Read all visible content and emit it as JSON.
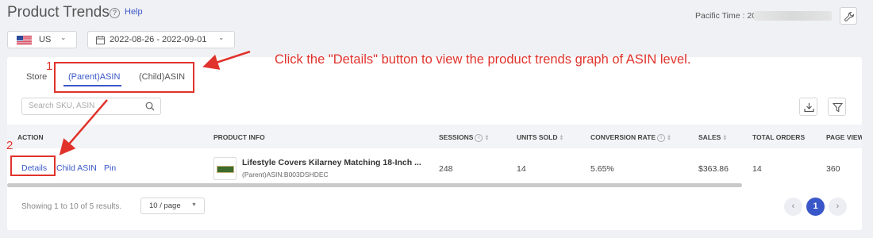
{
  "header": {
    "title": "Product Trends",
    "help_icon_glyph": "?",
    "help_label": "Help",
    "timezone_label": "Pacific Time :",
    "timezone_value": "2022-",
    "tool_icon": "wrench-icon"
  },
  "filters": {
    "country": "US",
    "country_flag": "us-flag-icon",
    "date_range": "2022-08-26 - 2022-09-01",
    "chevron": "⌄"
  },
  "tabs": [
    {
      "label": "Store"
    },
    {
      "label": "(Parent)ASIN",
      "active": true
    },
    {
      "label": "(Child)ASIN"
    }
  ],
  "search": {
    "placeholder": "Search SKU, ASIN"
  },
  "toolbar": {
    "download_icon": "download-icon",
    "filter_icon": "filter-icon"
  },
  "table": {
    "columns": {
      "action": "ACTION",
      "product_info": "PRODUCT INFO",
      "sessions": "SESSIONS",
      "units_sold": "UNITS SOLD",
      "conversion_rate": "CONVERSION RATE",
      "sales": "SALES",
      "total_orders": "TOTAL ORDERS",
      "page_views": "PAGE VIEW"
    },
    "info_glyph": "i",
    "rows": [
      {
        "actions": {
          "details": "Details",
          "child_asin": "Child ASIN",
          "pin": "Pin"
        },
        "product_name": "Lifestyle Covers Kilarney Matching 18-Inch ...",
        "asin": "(Parent)ASIN:B003DSHDEC",
        "sessions": "248",
        "units_sold": "14",
        "conversion_rate": "5.65%",
        "sales": "$363.86",
        "total_orders": "14",
        "page_views": "360"
      }
    ]
  },
  "pagination": {
    "summary": "Showing 1 to 10 of 5 results.",
    "page_size": "10 / page",
    "prev": "‹",
    "current_page": "1",
    "next": "›"
  },
  "annotations": {
    "marker1": "1",
    "marker2": "2",
    "instruction": "Click the \"Details\" button to view the product trends graph of ASIN level.",
    "color": "#e0332c"
  },
  "colors": {
    "accent": "#3a57c9",
    "annotation": "#e0332c"
  }
}
